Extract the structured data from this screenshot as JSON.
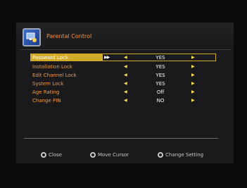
{
  "header": {
    "title": "Parental Control",
    "icon": "parental-control-icon"
  },
  "settings": [
    {
      "label": "Password Lock",
      "value": "YES",
      "selected": true
    },
    {
      "label": "Installation Lock",
      "value": "YES",
      "selected": false
    },
    {
      "label": "Edit Channel Lock",
      "value": "YES",
      "selected": false
    },
    {
      "label": "System Lock",
      "value": "YES",
      "selected": false
    },
    {
      "label": "Age Rating",
      "value": "Off",
      "selected": false
    },
    {
      "label": "Change PIN",
      "value": "NO",
      "selected": false
    }
  ],
  "footer": {
    "close": "Close",
    "move_cursor": "Move Cursor",
    "change_setting": "Change Setting"
  },
  "colors": {
    "accent": "#d2aa28",
    "label": "#ff9a3c",
    "arrow": "#ffe24a"
  }
}
